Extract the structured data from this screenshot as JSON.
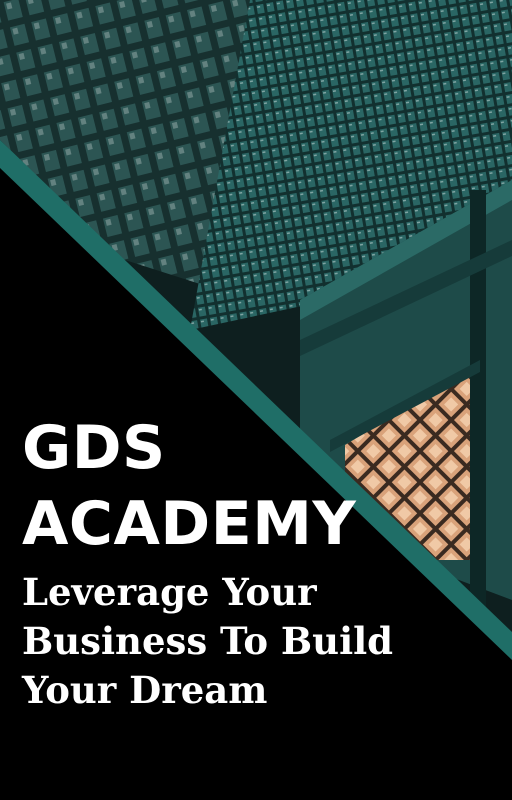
{
  "cover": {
    "title_line1": "GDS",
    "title_line2": "ACADEMY",
    "tagline_line1": "Leverage Your",
    "tagline_line2": "Business To Build",
    "tagline_line3": "Your Dream"
  },
  "colors": {
    "background": "#000000",
    "accent_band": "#1f6e67",
    "building_glass": "#1d4a48",
    "warm_lights": "#d9a27a",
    "text": "#ffffff"
  }
}
